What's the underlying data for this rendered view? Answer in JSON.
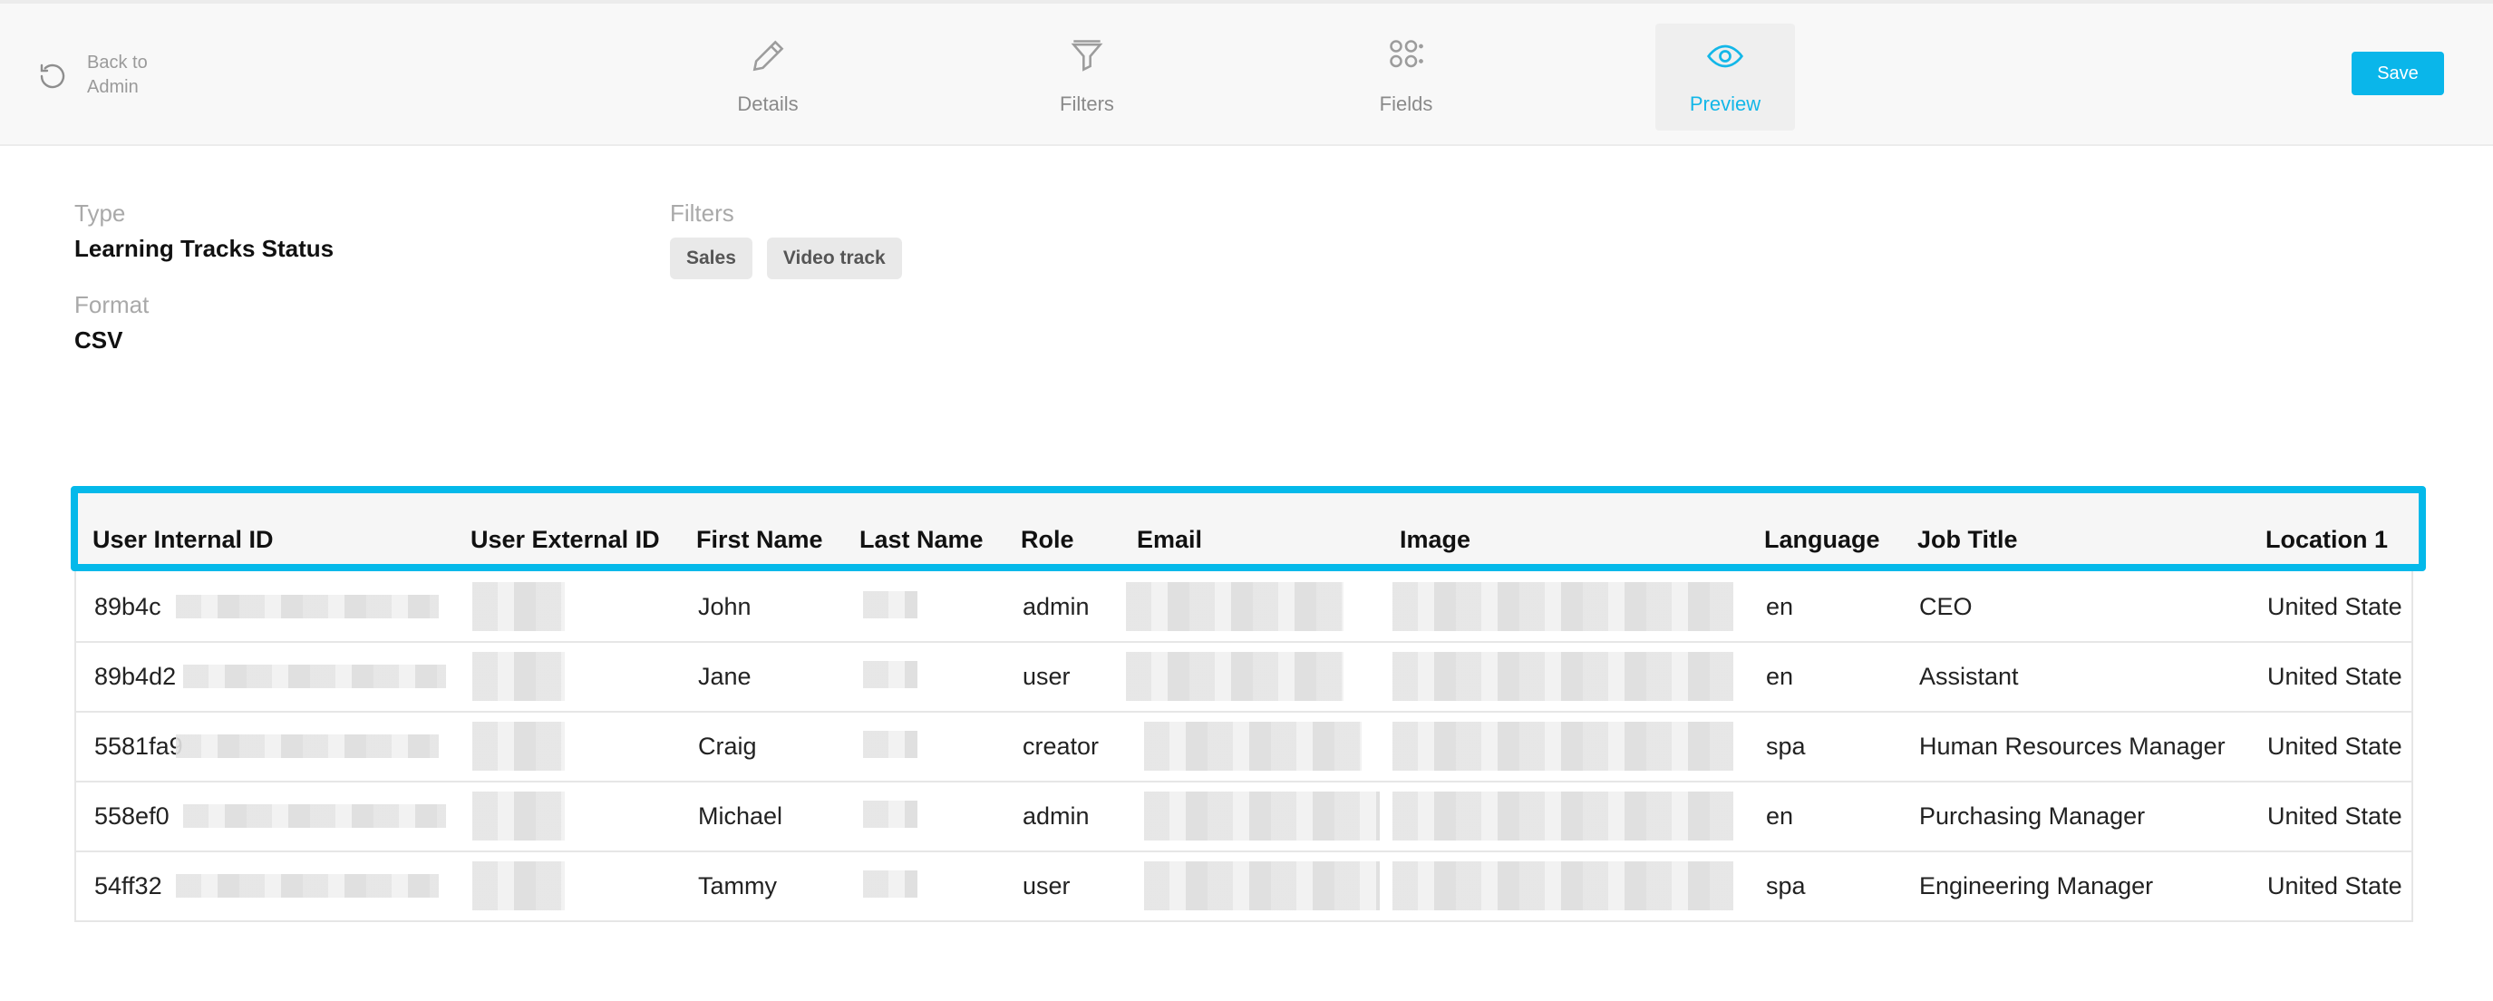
{
  "header": {
    "back_label": "Back to Admin",
    "tabs": [
      {
        "label": "Details",
        "icon": "pencil-icon",
        "active": false
      },
      {
        "label": "Filters",
        "icon": "filter-icon",
        "active": false
      },
      {
        "label": "Fields",
        "icon": "grid-icon",
        "active": false
      },
      {
        "label": "Preview",
        "icon": "eye-icon",
        "active": true
      }
    ],
    "save_label": "Save"
  },
  "info": {
    "type_label": "Type",
    "type_value": "Learning Tracks Status",
    "format_label": "Format",
    "format_value": "CSV",
    "filters_label": "Filters",
    "filters": [
      "Sales",
      "Video track"
    ]
  },
  "table": {
    "columns": [
      "User Internal ID",
      "User External ID",
      "First Name",
      "Last Name",
      "Role",
      "Email",
      "Image",
      "Language",
      "Job Title",
      "Location 1"
    ],
    "rows": [
      {
        "internal_id": "89b4c",
        "first": "John",
        "role": "admin",
        "lang": "en",
        "job": "CEO",
        "loc": "United State"
      },
      {
        "internal_id": "89b4d2",
        "first": "Jane",
        "role": "user",
        "lang": "en",
        "job": "Assistant",
        "loc": "United State"
      },
      {
        "internal_id": "5581fa9",
        "first": "Craig",
        "role": "creator",
        "lang": "spa",
        "job": "Human Resources Manager",
        "loc": "United State"
      },
      {
        "internal_id": "558ef0",
        "first": "Michael",
        "role": "admin",
        "lang": "en",
        "job": "Purchasing Manager",
        "loc": "United State"
      },
      {
        "internal_id": "54ff32",
        "first": "Tammy",
        "role": "user",
        "lang": "spa",
        "job": "Engineering Manager",
        "loc": "United State"
      }
    ]
  },
  "colors": {
    "accent": "#0ab6ea",
    "header_bg": "#f8f8f8"
  }
}
